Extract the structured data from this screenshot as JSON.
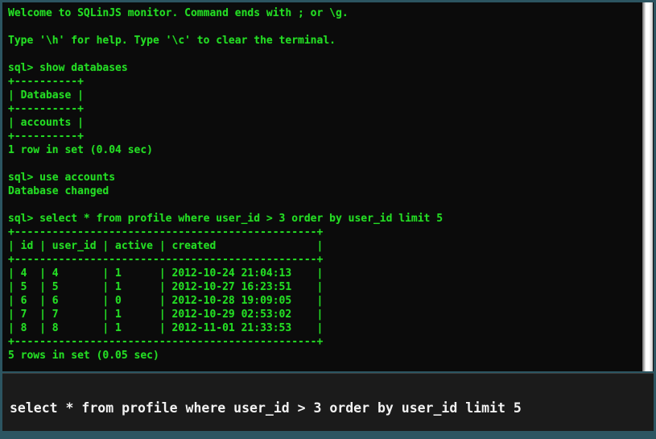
{
  "app": {
    "name": "SQLinJS monitor",
    "border_color": "#2c5561",
    "terminal_bg": "#0b0b0b",
    "terminal_fg": "#24dd24",
    "input_bg": "#1b1b1b",
    "input_fg": "#f2f2f2"
  },
  "terminal": {
    "lines": [
      "Welcome to SQLinJS monitor. Command ends with ; or \\g.",
      "",
      "Type '\\h' for help. Type '\\c' to clear the terminal.",
      "",
      "sql> show databases",
      "+----------+",
      "| Database |",
      "+----------+",
      "| accounts |",
      "+----------+",
      "1 row in set (0.04 sec)",
      "",
      "sql> use accounts",
      "Database changed",
      "",
      "sql> select * from profile where user_id > 3 order by user_id limit 5",
      "+------------------------------------------------+",
      "| id | user_id | active | created                |",
      "+------------------------------------------------+",
      "| 4  | 4       | 1      | 2012-10-24 21:04:13    |",
      "| 5  | 5       | 1      | 2012-10-27 16:23:51    |",
      "| 6  | 6       | 0      | 2012-10-28 19:09:05    |",
      "| 7  | 7       | 1      | 2012-10-29 02:53:02    |",
      "| 8  | 8       | 1      | 2012-11-01 21:33:53    |",
      "+------------------------------------------------+",
      "5 rows in set (0.05 sec)"
    ],
    "welcome": {
      "greeting": "Welcome to SQLinJS monitor. Command ends with ; or \\g.",
      "help_hint": "Type '\\h' for help. Type '\\c' to clear the terminal."
    },
    "prompt": "sql>",
    "commands": [
      {
        "command": "show databases",
        "result_status": "1 row in set (0.04 sec)",
        "table": {
          "headers": [
            "Database"
          ],
          "rows": [
            [
              "accounts"
            ]
          ]
        }
      },
      {
        "command": "use accounts",
        "result_status": "Database changed"
      },
      {
        "command": "select * from profile where user_id > 3 order by user_id limit 5",
        "result_status": "5 rows in set (0.05 sec)",
        "table": {
          "headers": [
            "id",
            "user_id",
            "active",
            "created"
          ],
          "rows": [
            [
              "4",
              "4",
              "1",
              "2012-10-24 21:04:13"
            ],
            [
              "5",
              "5",
              "1",
              "2012-10-27 16:23:51"
            ],
            [
              "6",
              "6",
              "0",
              "2012-10-28 19:09:05"
            ],
            [
              "7",
              "7",
              "1",
              "2012-10-29 02:53:02"
            ],
            [
              "8",
              "8",
              "1",
              "2012-11-01 21:33:53"
            ]
          ]
        }
      }
    ]
  },
  "command_bar": {
    "value": "select * from profile where user_id > 3 order by user_id limit 5",
    "placeholder": ""
  },
  "scrollbar": {
    "orientation": "vertical",
    "thumb_position": "full"
  }
}
